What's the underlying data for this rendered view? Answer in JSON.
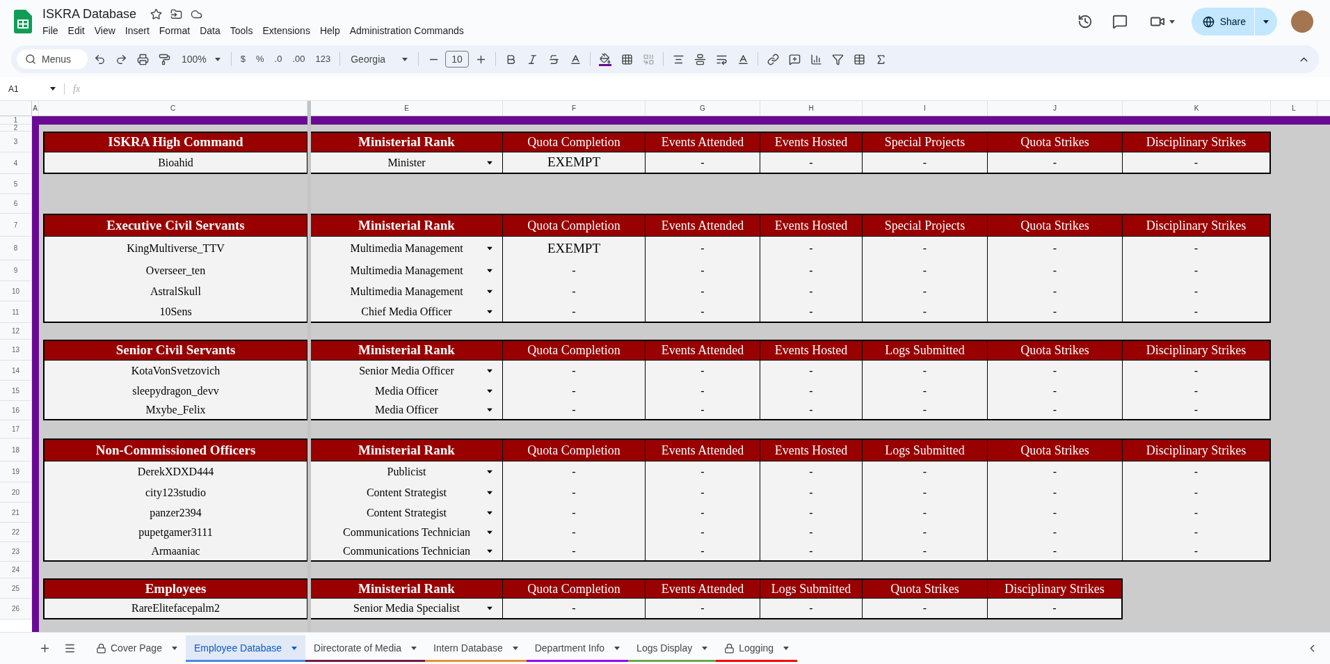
{
  "document": {
    "title": "ISKRA Database",
    "menus": [
      "File",
      "Edit",
      "View",
      "Insert",
      "Format",
      "Data",
      "Tools",
      "Extensions",
      "Help",
      "Administration Commands"
    ]
  },
  "toolbar": {
    "search": "Menus",
    "zoom": "100%",
    "currency": "$",
    "percent": "%",
    "decrease_decimals": ".0",
    "increase_decimals": ".00",
    "number_format": "123",
    "font": "Georgia",
    "font_size": "10"
  },
  "share": {
    "label": "Share"
  },
  "formula_bar": {
    "name_box": "A1",
    "fx": "fx"
  },
  "sheet": {
    "column_headers": [
      "A",
      "C",
      "E",
      "F",
      "G",
      "H",
      "I",
      "J",
      "K",
      "L"
    ],
    "rows": [
      {
        "number": "1",
        "kind": "band"
      },
      {
        "number": "2",
        "kind": "spacer"
      },
      {
        "number": "3",
        "kind": "header",
        "cells": [
          "ISKRA High Command",
          "Ministerial Rank",
          "Quota Completion",
          "Events Attended",
          "Events Hosted",
          "Special Projects",
          "Quota Strikes",
          "Disciplinary Strikes"
        ]
      },
      {
        "number": "4",
        "kind": "data",
        "cells": [
          "Bioahid",
          "Minister",
          "EXEMPT",
          "-",
          "-",
          "-",
          "-",
          "-"
        ]
      },
      {
        "number": "5",
        "kind": "spacer"
      },
      {
        "number": "6",
        "kind": "spacer"
      },
      {
        "number": "7",
        "kind": "header",
        "cells": [
          "Executive Civil Servants",
          "Ministerial Rank",
          "Quota Completion",
          "Events Attended",
          "Events Hosted",
          "Special Projects",
          "Quota Strikes",
          "Disciplinary Strikes"
        ]
      },
      {
        "number": "8",
        "kind": "data",
        "cells": [
          "KingMultiverse_TTV",
          "Multimedia Management",
          "EXEMPT",
          "-",
          "-",
          "-",
          "-",
          "-"
        ]
      },
      {
        "number": "9",
        "kind": "data",
        "cells": [
          "Overseer_ten",
          "Multimedia Management",
          "-",
          "-",
          "-",
          "-",
          "-",
          "-"
        ]
      },
      {
        "number": "10",
        "kind": "data",
        "cells": [
          "AstralSkull",
          "Multimedia Management",
          "-",
          "-",
          "-",
          "-",
          "-",
          "-"
        ]
      },
      {
        "number": "11",
        "kind": "data",
        "cells": [
          "10Sens",
          "Chief Media Officer",
          "-",
          "-",
          "-",
          "-",
          "-",
          "-"
        ]
      },
      {
        "number": "12",
        "kind": "spacer"
      },
      {
        "number": "13",
        "kind": "header",
        "cells": [
          "Senior Civil Servants",
          "Ministerial Rank",
          "Quota Completion",
          "Events Attended",
          "Events Hosted",
          "Logs Submitted",
          "Quota Strikes",
          "Disciplinary Strikes"
        ]
      },
      {
        "number": "14",
        "kind": "data",
        "cells": [
          "KotaVonSvetzovich",
          "Senior Media Officer",
          "-",
          "-",
          "-",
          "-",
          "-",
          "-"
        ]
      },
      {
        "number": "15",
        "kind": "data",
        "cells": [
          "sleepydragon_devv",
          "Media Officer",
          "-",
          "-",
          "-",
          "-",
          "-",
          "-"
        ]
      },
      {
        "number": "16",
        "kind": "data",
        "cells": [
          "Mxybe_Felix",
          "Media Officer",
          "-",
          "-",
          "-",
          "-",
          "-",
          "-"
        ]
      },
      {
        "number": "17",
        "kind": "spacer"
      },
      {
        "number": "18",
        "kind": "header",
        "cells": [
          "Non-Commissioned Officers",
          "Ministerial Rank",
          "Quota Completion",
          "Events Attended",
          "Events Hosted",
          "Logs Submitted",
          "Quota Strikes",
          "Disciplinary Strikes"
        ]
      },
      {
        "number": "19",
        "kind": "data",
        "cells": [
          "DerekXDXD444",
          "Publicist",
          "-",
          "-",
          "-",
          "-",
          "-",
          "-"
        ]
      },
      {
        "number": "20",
        "kind": "data",
        "cells": [
          "city123studio",
          "Content Strategist",
          "-",
          "-",
          "-",
          "-",
          "-",
          "-"
        ]
      },
      {
        "number": "21",
        "kind": "data",
        "cells": [
          "panzer2394",
          "Content Strategist",
          "-",
          "-",
          "-",
          "-",
          "-",
          "-"
        ]
      },
      {
        "number": "22",
        "kind": "data",
        "cells": [
          "pupetgamer3111",
          "Communications Technician",
          "-",
          "-",
          "-",
          "-",
          "-",
          "-"
        ]
      },
      {
        "number": "23",
        "kind": "data",
        "cells": [
          "Armaaniac",
          "Communications Technician",
          "-",
          "-",
          "-",
          "-",
          "-",
          "-"
        ]
      },
      {
        "number": "24",
        "kind": "spacer"
      },
      {
        "number": "25",
        "kind": "header",
        "cells": [
          "Employees",
          "Ministerial Rank",
          "Quota Completion",
          "Events Attended",
          "Logs Submitted",
          "Quota Strikes",
          "Disciplinary Strikes"
        ]
      },
      {
        "number": "26",
        "kind": "data",
        "cells": [
          "RareElitefacepalm2",
          "Senior Media Specialist",
          "-",
          "-",
          "-",
          "-",
          "-"
        ]
      }
    ]
  },
  "tabs": [
    {
      "label": "Cover Page",
      "locked": true,
      "selected": false
    },
    {
      "label": "Employee Database",
      "locked": false,
      "selected": true,
      "color": "#4a86e8"
    },
    {
      "label": "Directorate of Media",
      "locked": false,
      "selected": false,
      "color": "#741b47"
    },
    {
      "label": "Intern Database",
      "locked": false,
      "selected": false,
      "color": "#e69138"
    },
    {
      "label": "Department Info",
      "locked": false,
      "selected": false,
      "color": "#9900ff"
    },
    {
      "label": "Logs Display",
      "locked": false,
      "selected": false,
      "color": "#6aa84f"
    },
    {
      "label": "Logging",
      "locked": true,
      "selected": false,
      "color": "#ff0000"
    }
  ]
}
